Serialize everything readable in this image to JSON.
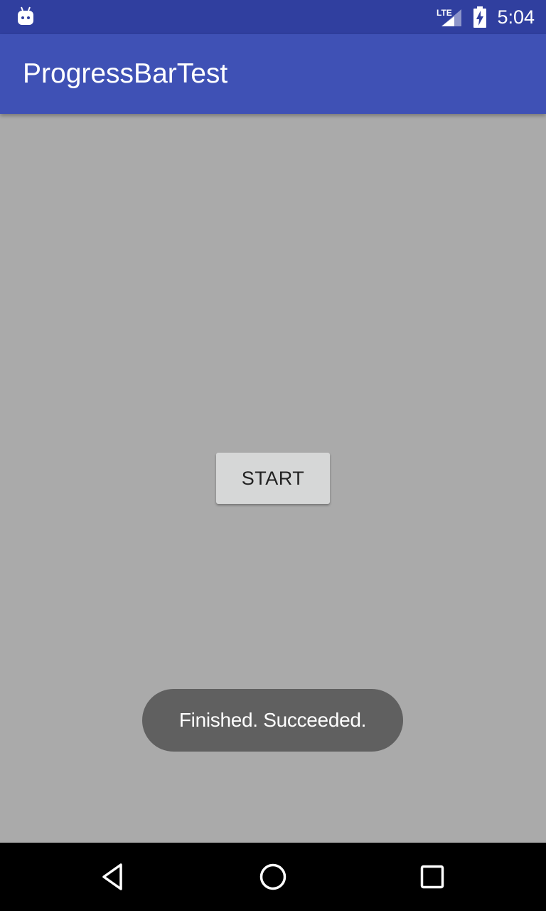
{
  "status_bar": {
    "time": "5:04",
    "network_label": "LTE",
    "notification_icon": "android-debug-icon",
    "signal_icon": "signal-icon",
    "battery_icon": "battery-charging-icon"
  },
  "app_bar": {
    "title": "ProgressBarTest"
  },
  "main": {
    "start_button_label": "START"
  },
  "toast": {
    "message": "Finished. Succeeded."
  },
  "nav_bar": {
    "back_icon": "back-triangle-icon",
    "home_icon": "home-circle-icon",
    "recents_icon": "recents-square-icon"
  },
  "colors": {
    "status_bar": "#303f9f",
    "app_bar": "#3f51b5",
    "background": "#aaaaaa",
    "button": "#d6d7d7",
    "toast": "#606060",
    "nav_bar": "#000000"
  }
}
